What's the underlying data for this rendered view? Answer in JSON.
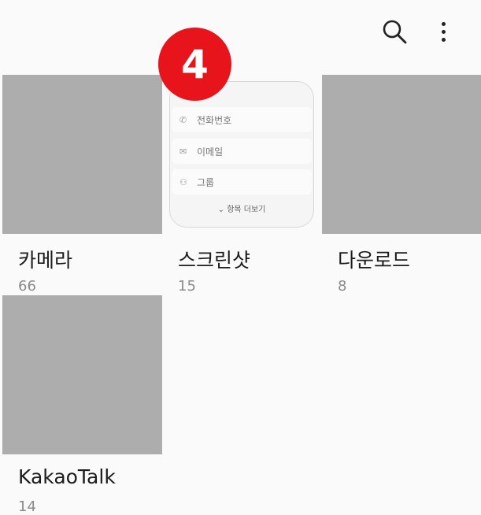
{
  "toolbar": {
    "search_icon": "search-icon",
    "more_icon": "more-options-icon"
  },
  "badge": {
    "number": "4",
    "color": "#e8141b"
  },
  "albums": [
    {
      "name": "카메라",
      "count": "66"
    },
    {
      "name": "스크린샷",
      "count": "15"
    },
    {
      "name": "다운로드",
      "count": "8"
    },
    {
      "name": "KakaoTalk",
      "count": "14"
    }
  ],
  "screenshot_thumb": {
    "rows": [
      {
        "icon": "phone-icon",
        "label": "전화번호"
      },
      {
        "icon": "mail-icon",
        "label": "이메일"
      },
      {
        "icon": "group-icon",
        "label": "그룹"
      }
    ],
    "more_label": "항목 더보기"
  }
}
